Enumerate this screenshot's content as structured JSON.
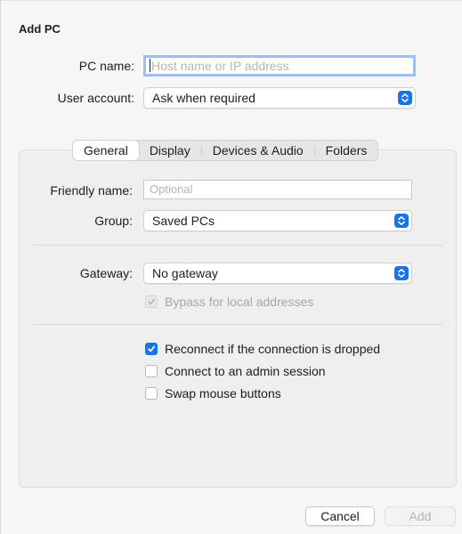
{
  "dialog": {
    "title": "Add PC"
  },
  "pc_name": {
    "label": "PC name:",
    "value": "",
    "placeholder": "Host name or IP address"
  },
  "user_account": {
    "label": "User account:",
    "value": "Ask when required"
  },
  "tabs": [
    {
      "label": "General",
      "selected": true
    },
    {
      "label": "Display",
      "selected": false
    },
    {
      "label": "Devices & Audio",
      "selected": false
    },
    {
      "label": "Folders",
      "selected": false
    }
  ],
  "general": {
    "friendly_name": {
      "label": "Friendly name:",
      "value": "",
      "placeholder": "Optional"
    },
    "group": {
      "label": "Group:",
      "value": "Saved PCs"
    },
    "gateway": {
      "label": "Gateway:",
      "value": "No gateway"
    },
    "bypass": {
      "label": "Bypass for local addresses",
      "checked": true,
      "enabled": false
    },
    "reconnect": {
      "label": "Reconnect if the connection is dropped",
      "checked": true
    },
    "admin_session": {
      "label": "Connect to an admin session",
      "checked": false
    },
    "swap_mouse": {
      "label": "Swap mouse buttons",
      "checked": false
    }
  },
  "buttons": {
    "cancel": "Cancel",
    "add": "Add"
  },
  "colors": {
    "accent": "#1a73e8",
    "focus_ring": "#9cc0f2"
  }
}
